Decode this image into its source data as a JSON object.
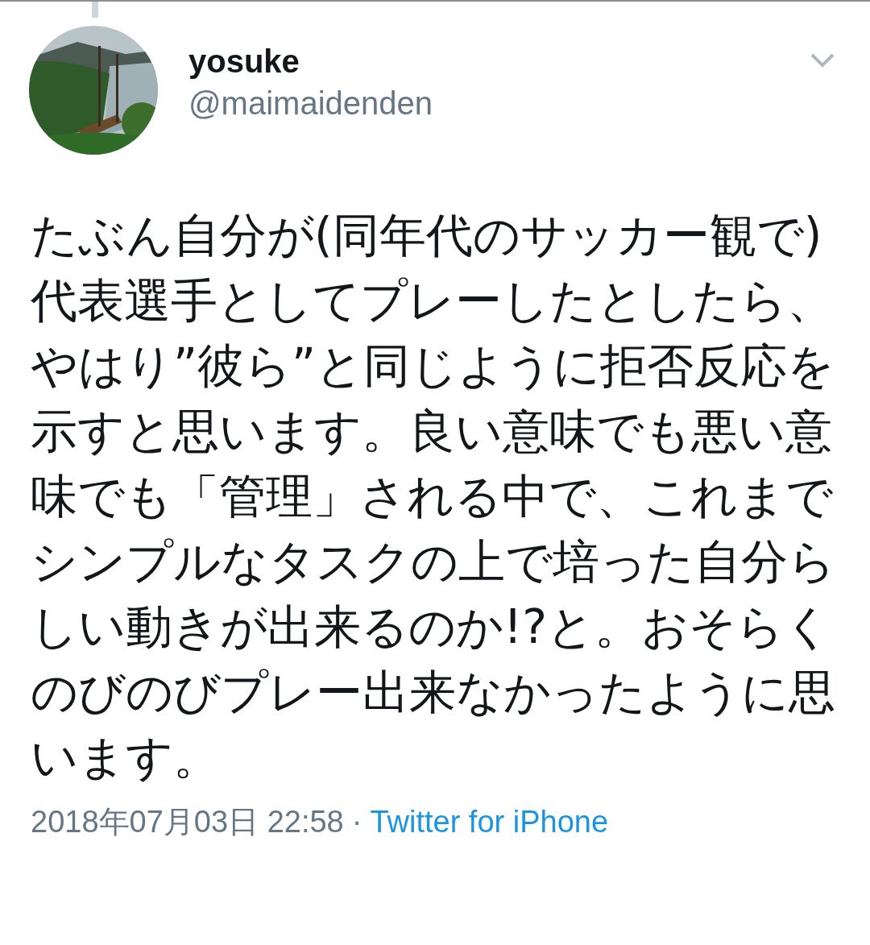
{
  "tweet": {
    "name": "yosuke",
    "handle": "@maimaidenden",
    "text": "たぶん自分が(同年代のサッカー観で)代表選手としてプレーしたとしたら、やはり”彼ら”と同じように拒否反応を示すと思います。良い意味でも悪い意味でも「管理」される中で、これまでシンプルなタスクの上で培った自分らしい動きが出来るのか!?と。おそらくのびのびプレー出来なかったように思います。",
    "timestamp": "2018年07月03日 22:58",
    "separator": "·",
    "source": "Twitter for iPhone"
  }
}
